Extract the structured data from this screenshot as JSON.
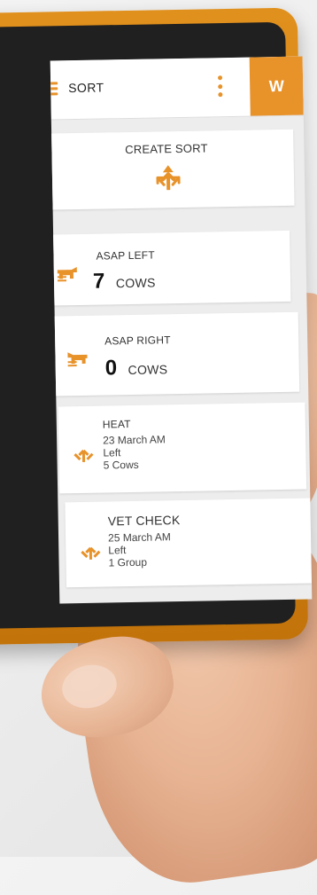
{
  "app": {
    "title": "SORT",
    "brand_letter": "W",
    "accent": "#e8922a"
  },
  "create_sort": {
    "label": "CREATE SORT",
    "icon": "split-arrows-icon"
  },
  "cards": [
    {
      "title": "ASAP LEFT",
      "count": "7",
      "unit": "COWS",
      "icon": "cow-left-icon"
    },
    {
      "title": "ASAP RIGHT",
      "count": "0",
      "unit": "COWS",
      "icon": "cow-right-icon"
    },
    {
      "title": "HEAT",
      "lines": [
        "23 March AM",
        "Left",
        "5 Cows"
      ],
      "icon": "split-arrows-icon"
    },
    {
      "title": "VET CHECK",
      "lines": [
        "25 March AM",
        "Left",
        "1 Group"
      ],
      "icon": "split-arrows-icon"
    }
  ]
}
